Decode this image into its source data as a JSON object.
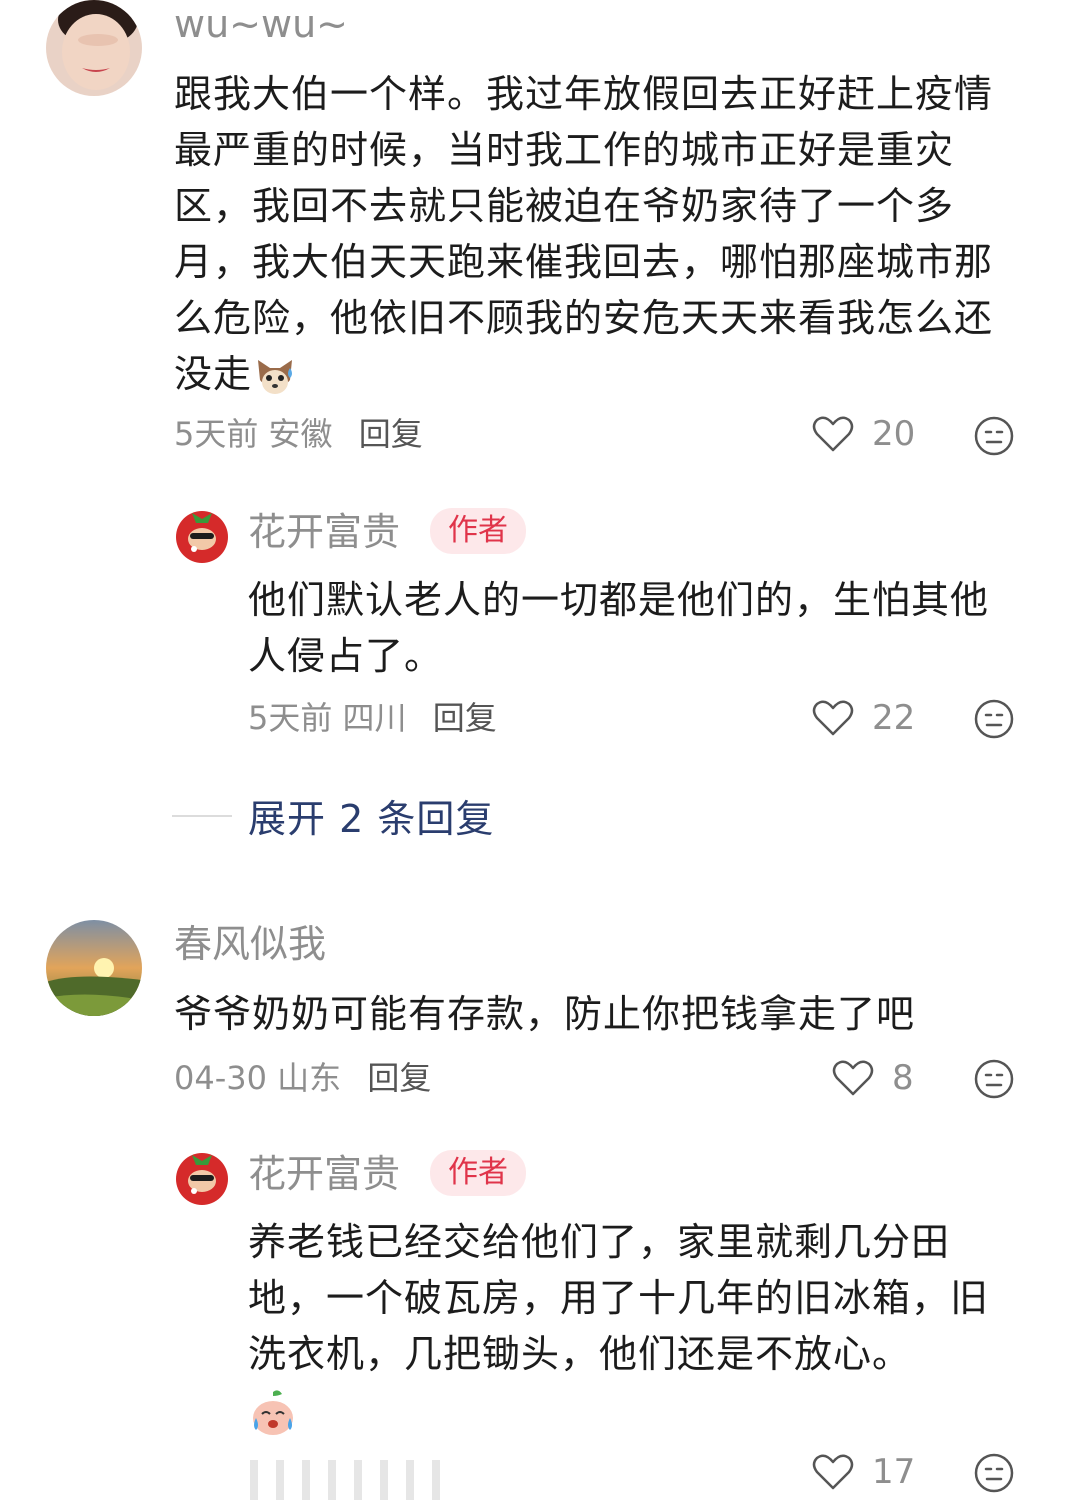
{
  "comments": [
    {
      "username": "wu~wu~",
      "text": "跟我大伯一个样。我过年放假回去正好赶上疫情最严重的时候，当时我工作的城市正好是重灾区，我回不去就只能被迫在爷奶家待了一个多月，我大伯天天跑来催我回去，哪怕那座城市那么危险，他依旧不顾我的安危天天来看我怎么还没走",
      "time": "5天前",
      "location": "安徽",
      "reply_label": "回复",
      "likes": "20",
      "reply": {
        "username": "花开富贵",
        "badge": "作者",
        "text": "他们默认老人的一切都是他们的，生怕其他人侵占了。",
        "time": "5天前",
        "location": "四川",
        "reply_label": "回复",
        "likes": "22"
      },
      "expand_label": "展开 2 条回复"
    },
    {
      "username": "春风似我",
      "text": "爷爷奶奶可能有存款，防止你把钱拿走了吧",
      "time": "04-30",
      "location": "山东",
      "reply_label": "回复",
      "likes": "8",
      "reply": {
        "username": "花开富贵",
        "badge": "作者",
        "text": "养老钱已经交给他们了，家里就剩几分田地，一个破瓦房，用了十几年的旧冰箱，旧洗衣机，几把锄头，他们还是不放心。",
        "likes": "17"
      }
    }
  ],
  "icons": {
    "like": "heart-outline-icon",
    "emoji": "emoji-face-icon",
    "inline1": "chihuahua-sweat-emoji",
    "inline2": "crying-peach-emoji"
  },
  "colors": {
    "badge_bg": "#fde8ea",
    "badge_text": "#e0344a",
    "expand": "#2a3d6e"
  }
}
